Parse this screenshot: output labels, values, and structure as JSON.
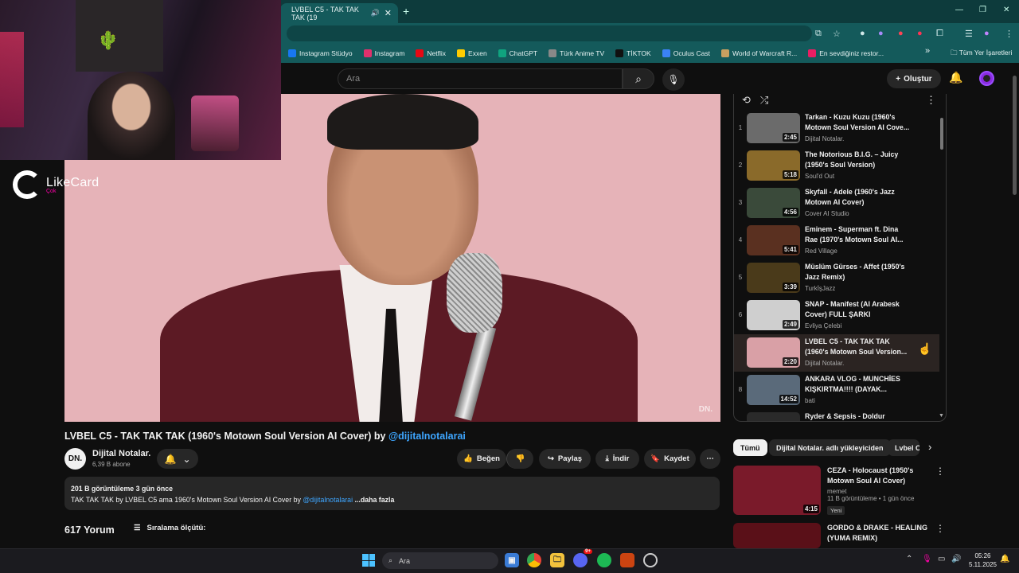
{
  "browser": {
    "tab_title": "LVBEL C5 - TAK TAK TAK (19",
    "bookmarks": [
      "Instagram Stüdyo",
      "Instagram",
      "Netflix",
      "Exxen",
      "ChatGPT",
      "Türk Anime TV",
      "TİKTOK",
      "Oculus Cast",
      "World of Warcraft R...",
      "En sevdiğiniz restor..."
    ],
    "bookmark_colors": [
      "#1877f2",
      "#e1306c",
      "#e50914",
      "#ffcc00",
      "#10a37f",
      "#888888",
      "#111111",
      "#3b82f6",
      "#c8a060",
      "#e91e63"
    ],
    "all_bookmarks": "Tüm Yer İşaretleri"
  },
  "youtube": {
    "search_placeholder": "Ara",
    "create_label": "Oluştur"
  },
  "overlay": {
    "brand": "LikeCard",
    "brand_sub": "Çok"
  },
  "video": {
    "title_main": "LVBEL C5 - TAK TAK TAK (1960's Motown Soul Version AI Cover) by",
    "title_mention": "@dijitalnotalarai",
    "watermark": "DN.",
    "channel_logo": "DN.",
    "channel_name": "Dijital Notalar.",
    "subscribers": "6,39 B abone",
    "like_label": "Beğen",
    "share_label": "Paylaş",
    "download_label": "İndir",
    "save_label": "Kaydet",
    "views_line": "201 B görüntüleme  3 gün önce",
    "desc_text": "TAK TAK TAK by LVBEL C5 ama 1960's Motown Soul Version AI Cover by",
    "desc_mention": "@dijitalnotalarai",
    "desc_more": " ...daha fazla",
    "comments_count": "617 Yorum",
    "sort_label": "Sıralama ölçütü:"
  },
  "playlist": [
    {
      "idx": "1",
      "title": "Tarkan - Kuzu Kuzu (1960's Motown Soul Version AI Cove...",
      "channel": "Dijital Notalar.",
      "duration": "2:45",
      "color": "#6b6b6b"
    },
    {
      "idx": "2",
      "title": "The Notorious B.I.G. – Juicy (1950's Soul Version)",
      "channel": "Soul'd Out",
      "duration": "5:18",
      "color": "#8a6a2a"
    },
    {
      "idx": "3",
      "title": "Skyfall - Adele (1960's Jazz Motown AI Cover)",
      "channel": "Cover AI Studio",
      "duration": "4:56",
      "color": "#3a4a3a"
    },
    {
      "idx": "4",
      "title": "Eminem - Superman ft. Dina Rae (1970's Motown Soul AI...",
      "channel": "Red Village",
      "duration": "5:41",
      "color": "#5a3020"
    },
    {
      "idx": "5",
      "title": "Müslüm Gürses - Affet (1950's Jazz Remix)",
      "channel": "TurkİşJazz",
      "duration": "3:39",
      "color": "#4a3a1a"
    },
    {
      "idx": "6",
      "title": "SNAP - Manifest (AI Arabesk Cover) FULL ŞARKI",
      "channel": "Evliya Çelebi",
      "duration": "2:49",
      "color": "#cfcfcf"
    },
    {
      "idx": "",
      "title": "LVBEL C5 - TAK TAK TAK (1960's Motown Soul Version...",
      "channel": "Dijital Notalar.",
      "duration": "2:20",
      "color": "#d9a0a6"
    },
    {
      "idx": "8",
      "title": "ANKARA VLOG - MUNCHİES KIŞKIRTMA!!!! (DAYAK...",
      "channel": "bati",
      "duration": "14:52",
      "color": "#5a6a7a"
    },
    {
      "idx": "",
      "title": "Ryder & Sepsis - Doldur",
      "channel": "",
      "duration": "",
      "color": "#2a2a2a"
    }
  ],
  "chips": [
    "Tümü",
    "Dijital Notalar. adlı yükleyiciden",
    "Lvbel C"
  ],
  "related": [
    {
      "title": "CEZA - Holocaust (1950's Motown Soul AI Cover)",
      "channel": "memet",
      "stats": "11 B görüntüleme • 1 gün önce",
      "badge": "Yeni",
      "duration": "4:15",
      "color": "#7a1a2a"
    },
    {
      "title": "GORDO & DRAKE - HEALING (YUMA REMIX)",
      "channel": "",
      "stats": "",
      "badge": "",
      "duration": "",
      "color": "#5a1018"
    }
  ],
  "taskbar": {
    "search_label": "Ara",
    "time": "05:26",
    "date": "5.11.2025",
    "discord_badge": "9+"
  }
}
